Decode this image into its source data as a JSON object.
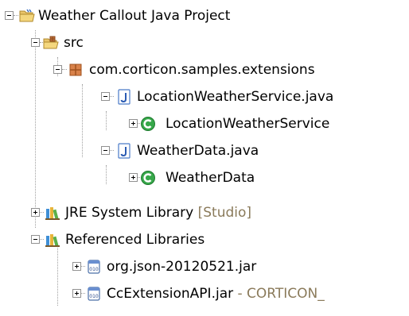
{
  "tree": {
    "rows": [
      {
        "label": "Weather Callout Java Project",
        "icon": "java-project-folder-icon",
        "expanded": true
      },
      {
        "label": "src",
        "icon": "source-folder-icon",
        "expanded": true
      },
      {
        "label": "com.corticon.samples.extensions",
        "icon": "package-icon",
        "expanded": true
      },
      {
        "label": "LocationWeatherService.java",
        "icon": "java-file-icon",
        "expanded": true
      },
      {
        "label": "LocationWeatherService",
        "icon": "class-icon",
        "expanded": false
      },
      {
        "label": "WeatherData.java",
        "icon": "java-file-icon",
        "expanded": true
      },
      {
        "label": "WeatherData",
        "icon": "class-icon",
        "expanded": false
      },
      {
        "label": "JRE System Library",
        "decoration": "[Studio]",
        "icon": "library-icon",
        "expanded": false
      },
      {
        "label": "Referenced Libraries",
        "icon": "library-icon",
        "expanded": true
      },
      {
        "label": "org.json-20120521.jar",
        "icon": "jar-icon",
        "expanded": false
      },
      {
        "label": "CcExtensionAPI.jar",
        "decoration": "- CORTICON_",
        "icon": "jar-icon",
        "expanded": false
      }
    ]
  },
  "colors": {
    "text": "#000000",
    "decoration": "#8a7a5a",
    "tree_lines": "#a0a0a0",
    "class_icon": "#2e9e3e",
    "java_file": "#2a5bb3",
    "package": "#b5651d",
    "folder": "#e7c25a"
  }
}
